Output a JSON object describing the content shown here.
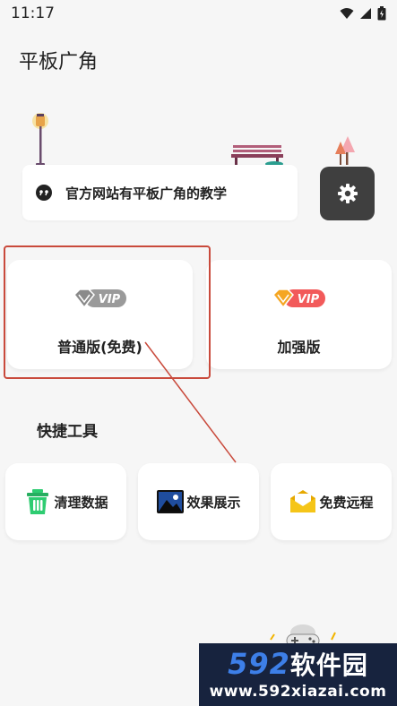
{
  "status_bar": {
    "time": "11:17"
  },
  "app": {
    "title": "平板广角"
  },
  "notice": {
    "text": "官方网站有平板广角的教学"
  },
  "versions": {
    "normal": {
      "badge": "VIP",
      "label": "普通版(免费)"
    },
    "plus": {
      "badge": "VIP",
      "label": "加强版"
    }
  },
  "tools": {
    "title": "快捷工具",
    "items": [
      {
        "label": "清理数据",
        "icon": "trash-icon"
      },
      {
        "label": "效果展示",
        "icon": "image-icon"
      },
      {
        "label": "免费远程",
        "icon": "envelope-icon"
      }
    ]
  },
  "watermark": {
    "brand_digits": "592",
    "brand_text": "软件园",
    "url": "www.592xiazai.com"
  },
  "colors": {
    "background": "#f6f6f6",
    "settings_button": "#3f3f3f",
    "highlight": "#c94a3c",
    "trash": "#2ecc71",
    "image": "#1f4d9e",
    "envelope": "#f5c518",
    "vip_gray": "#8a8a8a",
    "vip_orange": "#f08a2c",
    "watermark_bg": "#17233e"
  }
}
